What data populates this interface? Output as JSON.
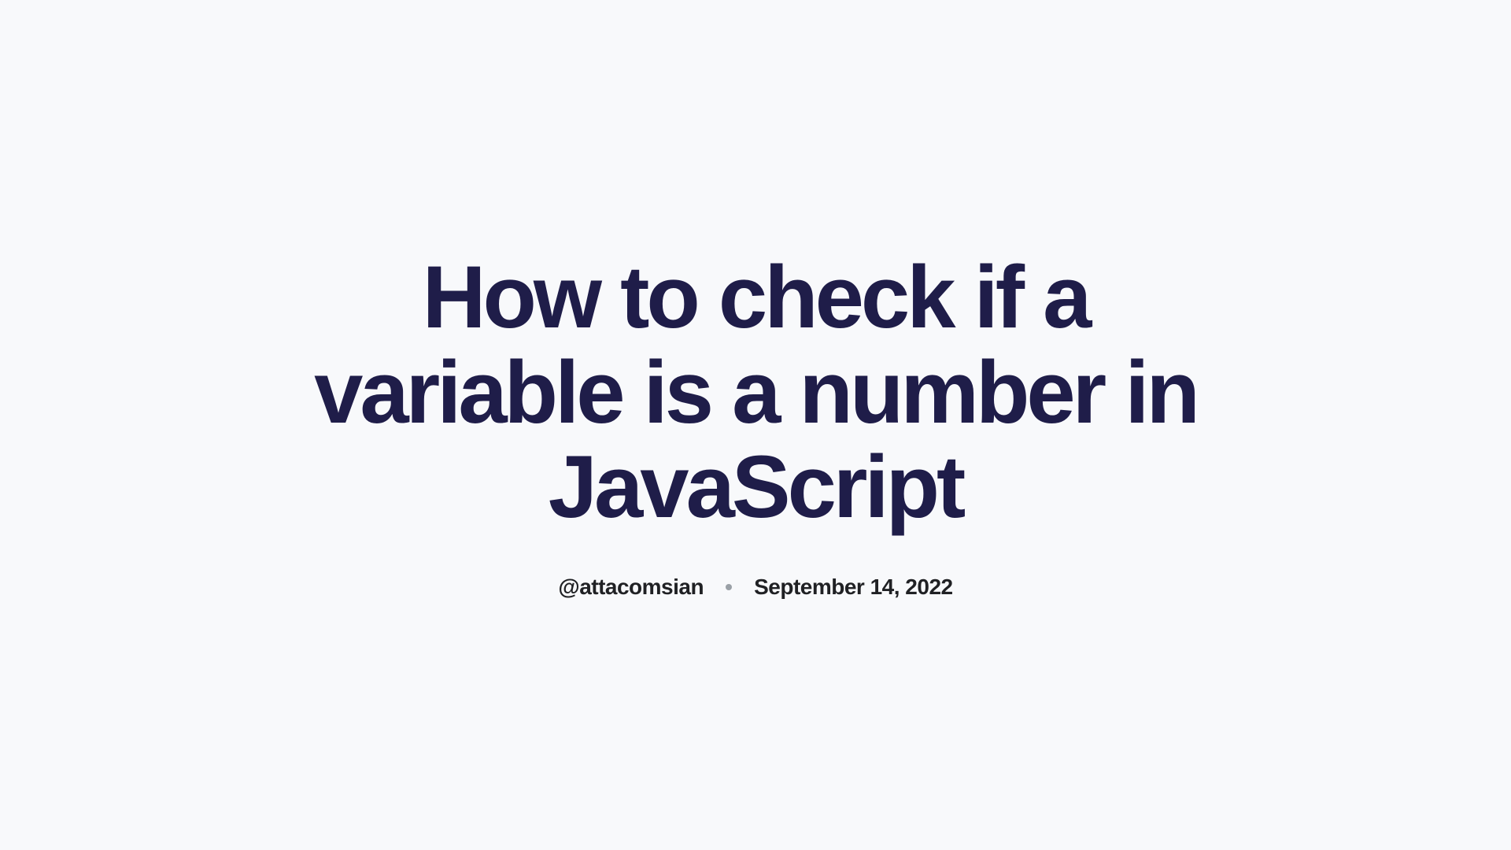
{
  "article": {
    "title": "How to check if a variable is a number in JavaScript",
    "author_handle": "@attacomsian",
    "publish_date": "September 14, 2022"
  }
}
